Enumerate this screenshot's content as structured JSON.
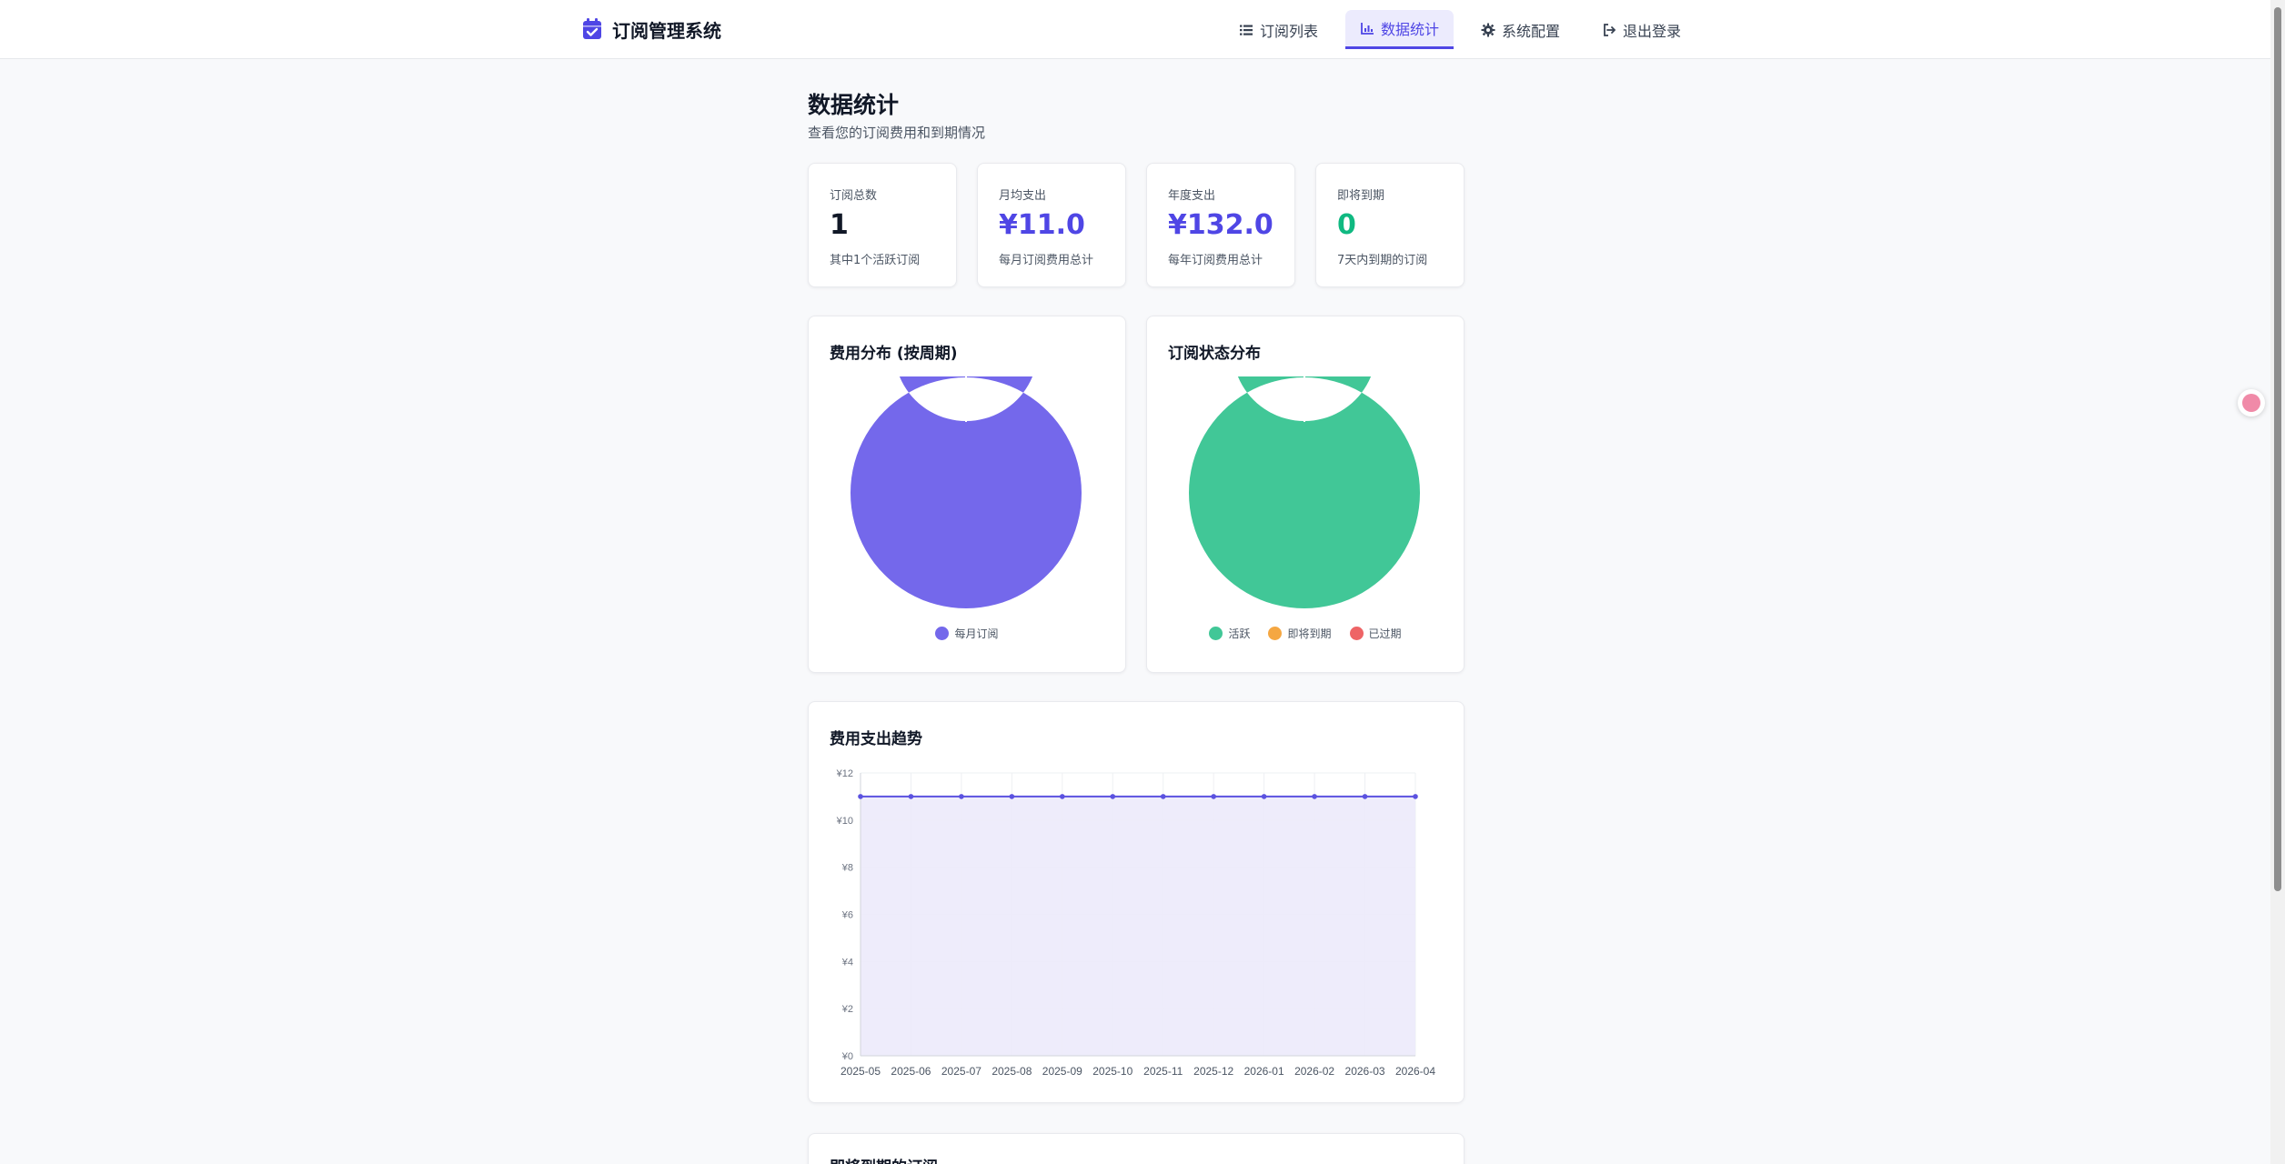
{
  "brand": {
    "title": "订阅管理系统",
    "icon": "calendar-check-icon",
    "color": "#4f46e5"
  },
  "nav": {
    "items": [
      {
        "label": "订阅列表",
        "icon": "list-icon",
        "active": false
      },
      {
        "label": "数据统计",
        "icon": "chart-icon",
        "active": true
      },
      {
        "label": "系统配置",
        "icon": "gear-icon",
        "active": false
      },
      {
        "label": "退出登录",
        "icon": "logout-icon",
        "active": false
      }
    ]
  },
  "page": {
    "title": "数据统计",
    "subtitle": "查看您的订阅费用和到期情况"
  },
  "stats": [
    {
      "label": "订阅总数",
      "value": "1",
      "desc": "其中1个活跃订阅",
      "color": "#111827"
    },
    {
      "label": "月均支出",
      "value": "¥11.0",
      "desc": "每月订阅费用总计",
      "color": "#4f46e5"
    },
    {
      "label": "年度支出",
      "value": "¥132.0",
      "desc": "每年订阅费用总计",
      "color": "#4f46e5"
    },
    {
      "label": "即将到期",
      "value": "0",
      "desc": "7天内到期的订阅",
      "color": "#10b981"
    }
  ],
  "cost_distribution": {
    "title": "费用分布 (按周期)",
    "legend": [
      {
        "label": "每月订阅",
        "color": "#7468eb"
      }
    ]
  },
  "status_distribution": {
    "title": "订阅状态分布",
    "legend": [
      {
        "label": "活跃",
        "color": "#41c797"
      },
      {
        "label": "即将到期",
        "color": "#f5a742"
      },
      {
        "label": "已过期",
        "color": "#ee6466"
      }
    ]
  },
  "trend": {
    "title": "费用支出趋势"
  },
  "upcoming": {
    "title": "即将到期的订阅"
  },
  "chart_data": [
    {
      "type": "pie",
      "title": "费用分布 (按周期)",
      "donut": true,
      "categories": [
        "每月订阅"
      ],
      "values": [
        11
      ],
      "colors": [
        "#7468eb"
      ],
      "legend": "bottom"
    },
    {
      "type": "pie",
      "title": "订阅状态分布",
      "donut": true,
      "categories": [
        "活跃",
        "即将到期",
        "已过期"
      ],
      "values": [
        1,
        0,
        0
      ],
      "colors": [
        "#41c797",
        "#f5a742",
        "#ee6466"
      ],
      "legend": "bottom"
    },
    {
      "type": "area",
      "title": "费用支出趋势",
      "x": [
        "2025-05",
        "2025-06",
        "2025-07",
        "2025-08",
        "2025-09",
        "2025-10",
        "2025-11",
        "2025-12",
        "2026-01",
        "2026-02",
        "2026-03",
        "2026-04"
      ],
      "series": [
        {
          "values": [
            11,
            11,
            11,
            11,
            11,
            11,
            11,
            11,
            11,
            11,
            11,
            11
          ]
        }
      ],
      "ylim": [
        0,
        12
      ],
      "yticks": [
        "¥0",
        "¥2",
        "¥4",
        "¥6",
        "¥8",
        "¥10",
        "¥12"
      ],
      "grid": true,
      "line_color": "#5b52e0",
      "fill_color": "#eceafb"
    }
  ]
}
